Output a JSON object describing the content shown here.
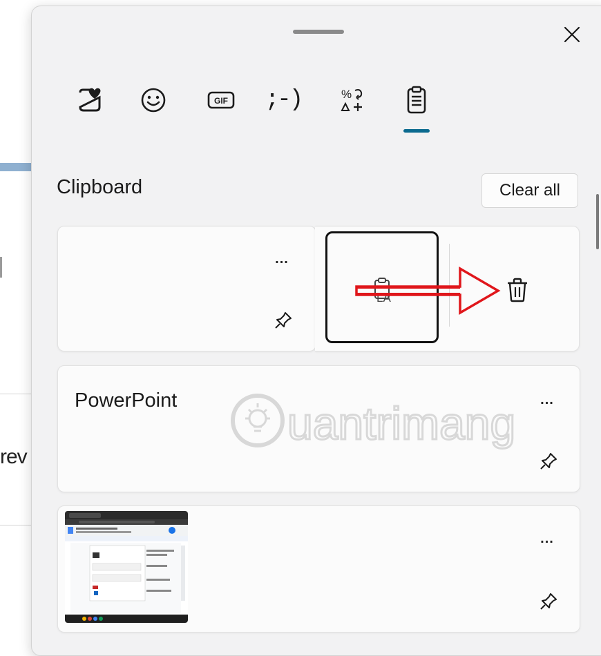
{
  "background": {
    "partial_text": "rev"
  },
  "panel": {
    "close_label": "Close",
    "tabs": [
      {
        "icon": "heart-sticker-icon"
      },
      {
        "icon": "emoji-smile-icon"
      },
      {
        "icon": "gif-icon",
        "text": "GIF"
      },
      {
        "icon": "kaomoji-icon",
        "text": ";-)"
      },
      {
        "icon": "symbols-icon",
        "text": "%↻\n∆+"
      },
      {
        "icon": "clipboard-icon",
        "selected": true
      }
    ],
    "section_title": "Clipboard",
    "clear_all_label": "Clear all",
    "items": [
      {
        "text": "",
        "more_label": "...",
        "pinned": false,
        "actions": [
          "paste-as-text-icon",
          "delete-icon"
        ]
      },
      {
        "text": "PowerPoint",
        "more_label": "...",
        "pinned": false
      },
      {
        "text": "",
        "more_label": "...",
        "pinned": false,
        "has_image": true
      }
    ],
    "watermark_text": "uantrimang"
  },
  "colors": {
    "panel_bg": "#f2f2f3",
    "accent": "#0b6a8f",
    "annotation_arrow": "#e0161b"
  }
}
